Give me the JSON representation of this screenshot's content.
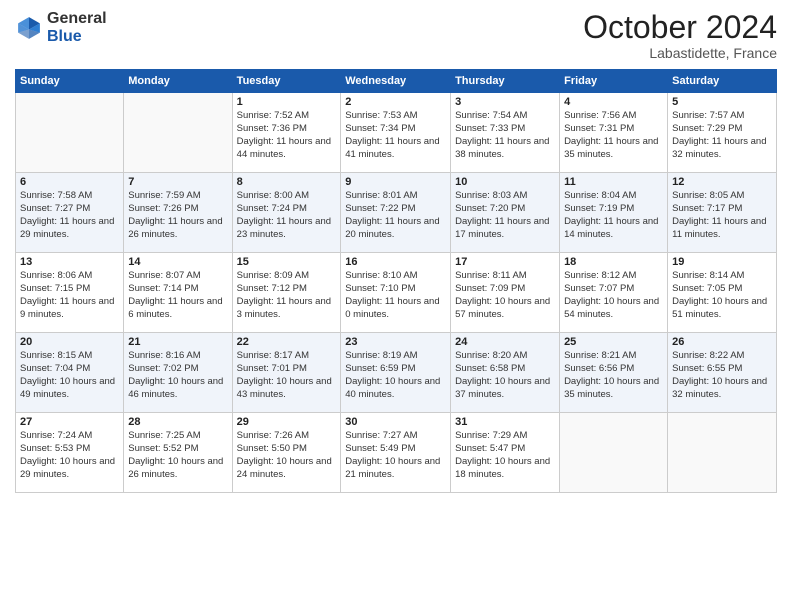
{
  "header": {
    "logo_general": "General",
    "logo_blue": "Blue",
    "month": "October 2024",
    "location": "Labastidette, France"
  },
  "weekdays": [
    "Sunday",
    "Monday",
    "Tuesday",
    "Wednesday",
    "Thursday",
    "Friday",
    "Saturday"
  ],
  "weeks": [
    [
      {
        "day": "",
        "info": ""
      },
      {
        "day": "",
        "info": ""
      },
      {
        "day": "1",
        "info": "Sunrise: 7:52 AM\nSunset: 7:36 PM\nDaylight: 11 hours and 44 minutes."
      },
      {
        "day": "2",
        "info": "Sunrise: 7:53 AM\nSunset: 7:34 PM\nDaylight: 11 hours and 41 minutes."
      },
      {
        "day": "3",
        "info": "Sunrise: 7:54 AM\nSunset: 7:33 PM\nDaylight: 11 hours and 38 minutes."
      },
      {
        "day": "4",
        "info": "Sunrise: 7:56 AM\nSunset: 7:31 PM\nDaylight: 11 hours and 35 minutes."
      },
      {
        "day": "5",
        "info": "Sunrise: 7:57 AM\nSunset: 7:29 PM\nDaylight: 11 hours and 32 minutes."
      }
    ],
    [
      {
        "day": "6",
        "info": "Sunrise: 7:58 AM\nSunset: 7:27 PM\nDaylight: 11 hours and 29 minutes."
      },
      {
        "day": "7",
        "info": "Sunrise: 7:59 AM\nSunset: 7:26 PM\nDaylight: 11 hours and 26 minutes."
      },
      {
        "day": "8",
        "info": "Sunrise: 8:00 AM\nSunset: 7:24 PM\nDaylight: 11 hours and 23 minutes."
      },
      {
        "day": "9",
        "info": "Sunrise: 8:01 AM\nSunset: 7:22 PM\nDaylight: 11 hours and 20 minutes."
      },
      {
        "day": "10",
        "info": "Sunrise: 8:03 AM\nSunset: 7:20 PM\nDaylight: 11 hours and 17 minutes."
      },
      {
        "day": "11",
        "info": "Sunrise: 8:04 AM\nSunset: 7:19 PM\nDaylight: 11 hours and 14 minutes."
      },
      {
        "day": "12",
        "info": "Sunrise: 8:05 AM\nSunset: 7:17 PM\nDaylight: 11 hours and 11 minutes."
      }
    ],
    [
      {
        "day": "13",
        "info": "Sunrise: 8:06 AM\nSunset: 7:15 PM\nDaylight: 11 hours and 9 minutes."
      },
      {
        "day": "14",
        "info": "Sunrise: 8:07 AM\nSunset: 7:14 PM\nDaylight: 11 hours and 6 minutes."
      },
      {
        "day": "15",
        "info": "Sunrise: 8:09 AM\nSunset: 7:12 PM\nDaylight: 11 hours and 3 minutes."
      },
      {
        "day": "16",
        "info": "Sunrise: 8:10 AM\nSunset: 7:10 PM\nDaylight: 11 hours and 0 minutes."
      },
      {
        "day": "17",
        "info": "Sunrise: 8:11 AM\nSunset: 7:09 PM\nDaylight: 10 hours and 57 minutes."
      },
      {
        "day": "18",
        "info": "Sunrise: 8:12 AM\nSunset: 7:07 PM\nDaylight: 10 hours and 54 minutes."
      },
      {
        "day": "19",
        "info": "Sunrise: 8:14 AM\nSunset: 7:05 PM\nDaylight: 10 hours and 51 minutes."
      }
    ],
    [
      {
        "day": "20",
        "info": "Sunrise: 8:15 AM\nSunset: 7:04 PM\nDaylight: 10 hours and 49 minutes."
      },
      {
        "day": "21",
        "info": "Sunrise: 8:16 AM\nSunset: 7:02 PM\nDaylight: 10 hours and 46 minutes."
      },
      {
        "day": "22",
        "info": "Sunrise: 8:17 AM\nSunset: 7:01 PM\nDaylight: 10 hours and 43 minutes."
      },
      {
        "day": "23",
        "info": "Sunrise: 8:19 AM\nSunset: 6:59 PM\nDaylight: 10 hours and 40 minutes."
      },
      {
        "day": "24",
        "info": "Sunrise: 8:20 AM\nSunset: 6:58 PM\nDaylight: 10 hours and 37 minutes."
      },
      {
        "day": "25",
        "info": "Sunrise: 8:21 AM\nSunset: 6:56 PM\nDaylight: 10 hours and 35 minutes."
      },
      {
        "day": "26",
        "info": "Sunrise: 8:22 AM\nSunset: 6:55 PM\nDaylight: 10 hours and 32 minutes."
      }
    ],
    [
      {
        "day": "27",
        "info": "Sunrise: 7:24 AM\nSunset: 5:53 PM\nDaylight: 10 hours and 29 minutes."
      },
      {
        "day": "28",
        "info": "Sunrise: 7:25 AM\nSunset: 5:52 PM\nDaylight: 10 hours and 26 minutes."
      },
      {
        "day": "29",
        "info": "Sunrise: 7:26 AM\nSunset: 5:50 PM\nDaylight: 10 hours and 24 minutes."
      },
      {
        "day": "30",
        "info": "Sunrise: 7:27 AM\nSunset: 5:49 PM\nDaylight: 10 hours and 21 minutes."
      },
      {
        "day": "31",
        "info": "Sunrise: 7:29 AM\nSunset: 5:47 PM\nDaylight: 10 hours and 18 minutes."
      },
      {
        "day": "",
        "info": ""
      },
      {
        "day": "",
        "info": ""
      }
    ]
  ]
}
